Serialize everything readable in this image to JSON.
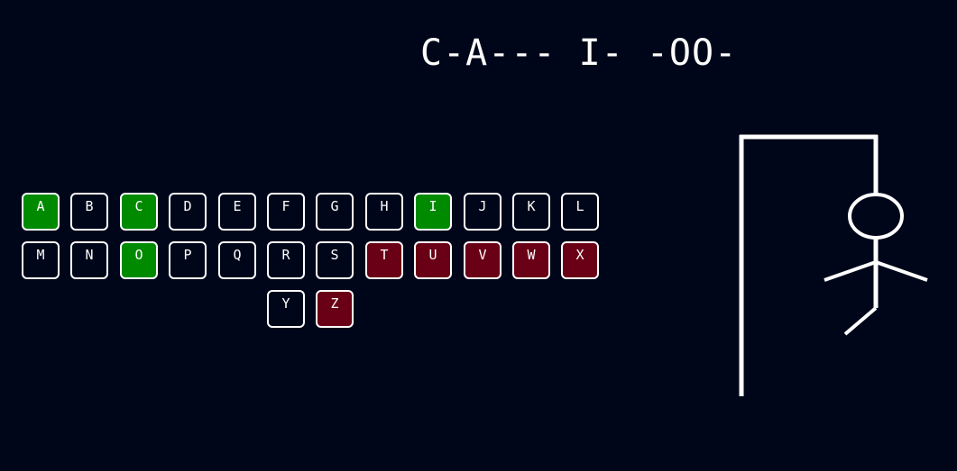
{
  "game": {
    "word_display": "C-A--- I- -OO-"
  },
  "keyboard": {
    "keys": [
      {
        "letter": "A",
        "state": "correct"
      },
      {
        "letter": "B",
        "state": "unused"
      },
      {
        "letter": "C",
        "state": "correct"
      },
      {
        "letter": "D",
        "state": "unused"
      },
      {
        "letter": "E",
        "state": "unused"
      },
      {
        "letter": "F",
        "state": "unused"
      },
      {
        "letter": "G",
        "state": "unused"
      },
      {
        "letter": "H",
        "state": "unused"
      },
      {
        "letter": "I",
        "state": "correct"
      },
      {
        "letter": "J",
        "state": "unused"
      },
      {
        "letter": "K",
        "state": "unused"
      },
      {
        "letter": "L",
        "state": "unused"
      },
      {
        "letter": "M",
        "state": "unused"
      },
      {
        "letter": "N",
        "state": "unused"
      },
      {
        "letter": "O",
        "state": "correct"
      },
      {
        "letter": "P",
        "state": "unused"
      },
      {
        "letter": "Q",
        "state": "unused"
      },
      {
        "letter": "R",
        "state": "unused"
      },
      {
        "letter": "S",
        "state": "unused"
      },
      {
        "letter": "T",
        "state": "wrong"
      },
      {
        "letter": "U",
        "state": "wrong"
      },
      {
        "letter": "V",
        "state": "wrong"
      },
      {
        "letter": "W",
        "state": "wrong"
      },
      {
        "letter": "X",
        "state": "wrong"
      },
      {
        "letter": "Y",
        "state": "unused"
      },
      {
        "letter": "Z",
        "state": "wrong"
      }
    ]
  },
  "colors": {
    "background": "#00061a",
    "correct": "#008a00",
    "wrong": "#6a0016",
    "outline": "#ffffff"
  },
  "hangman": {
    "parts_shown": [
      "gallows",
      "rope",
      "head",
      "body",
      "left-arm",
      "right-arm",
      "left-leg"
    ]
  }
}
